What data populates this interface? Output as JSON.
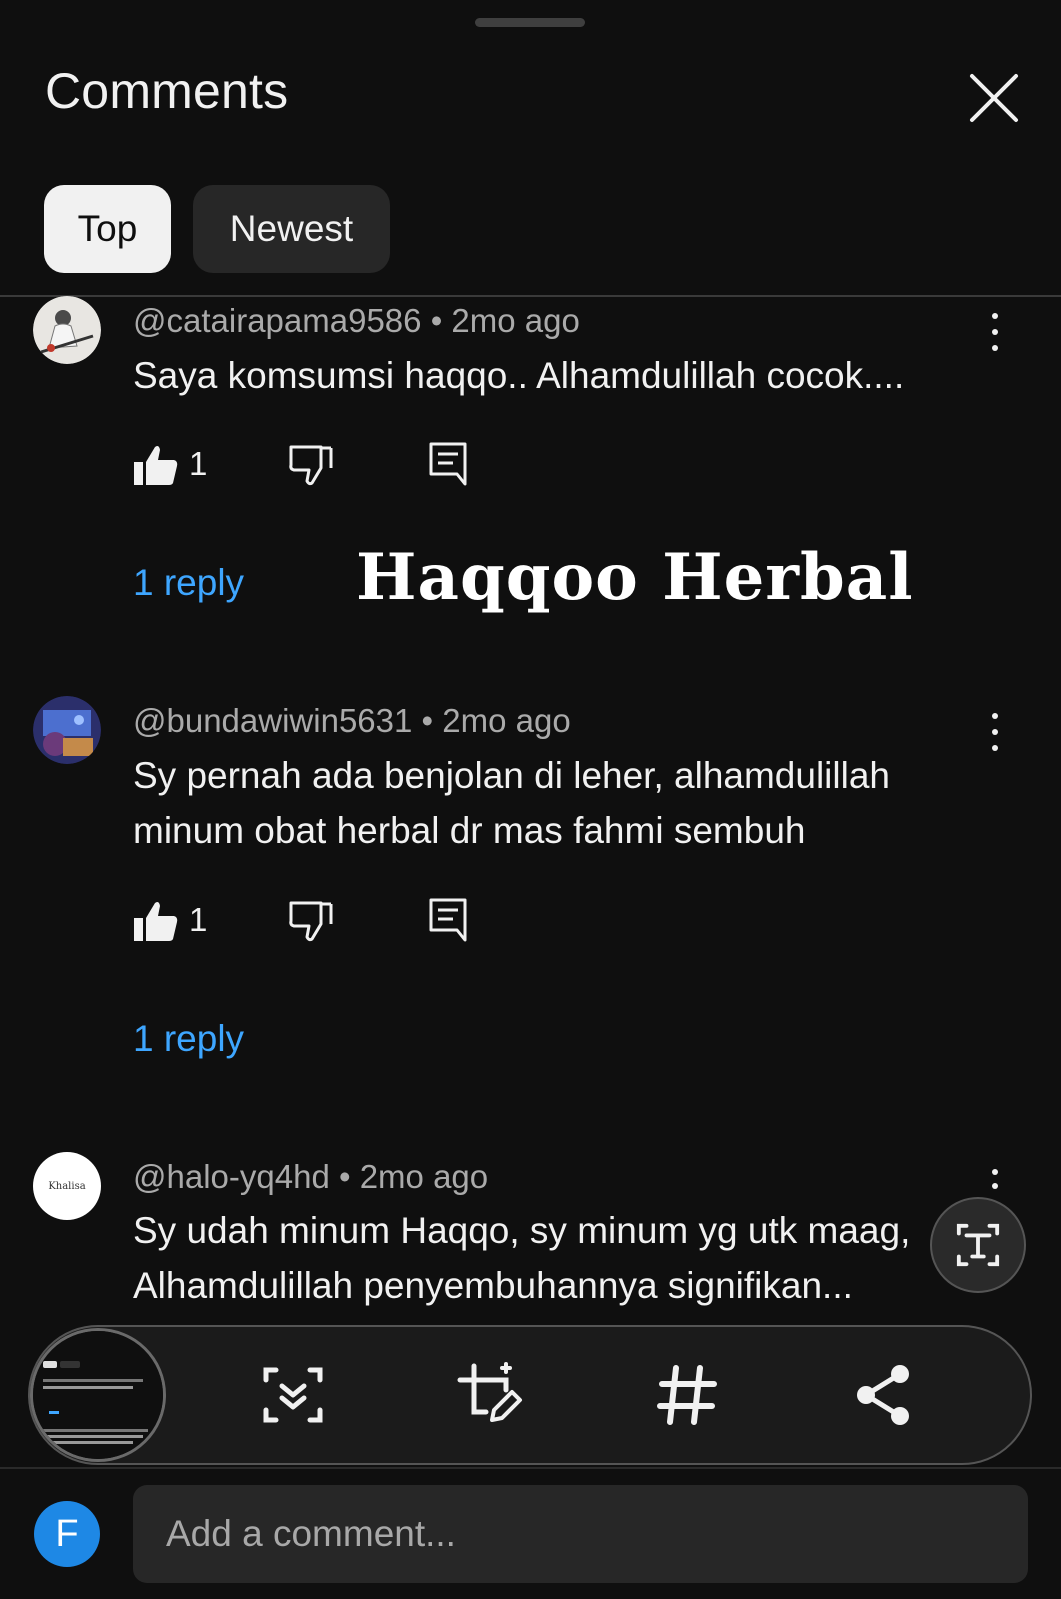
{
  "header": {
    "title": "Comments",
    "tabs": [
      {
        "label": "Top",
        "selected": true
      },
      {
        "label": "Newest",
        "selected": false
      }
    ]
  },
  "comments": [
    {
      "handle": "@catairapama9586",
      "time": "2mo ago",
      "lines": [
        "Saya komsumsi haqqo.. Alhamdulillah cocok...."
      ],
      "likes": "1",
      "replies": "1 reply"
    },
    {
      "handle": "@bundawiwin5631",
      "time": "2mo ago",
      "lines": [
        "Sy pernah ada benjolan di leher, alhamdulillah",
        "minum obat herbal dr mas fahmi sembuh"
      ],
      "likes": "1",
      "replies": "1 reply"
    },
    {
      "handle": "@halo-yq4hd",
      "time": "2mo ago",
      "lines": [
        "Sy udah minum Haqqo,  sy minum yg utk maag,",
        "Alhamdulillah penyembuhannya  signifikan..."
      ],
      "avatar_text": "Khalisa"
    }
  ],
  "overlay_text": "Haqqoo Herbal",
  "separator": "•",
  "composer": {
    "avatar_letter": "F",
    "placeholder": "Add a comment..."
  },
  "icons": {
    "close": "close-icon",
    "like": "thumbs-up-icon",
    "dislike": "thumbs-down-icon",
    "reply": "reply-icon",
    "more": "more-vert-icon",
    "text_extract": "text-extract-icon",
    "scan": "scan-icon",
    "edit_crop": "crop-edit-icon",
    "hashtag": "hashtag-icon",
    "share": "share-icon"
  },
  "colors": {
    "background": "#0f0f0f",
    "link": "#3ea6ff",
    "chip_selected": "#f1f1f1",
    "chip": "#272727",
    "composer_avatar": "#1e88e5"
  }
}
